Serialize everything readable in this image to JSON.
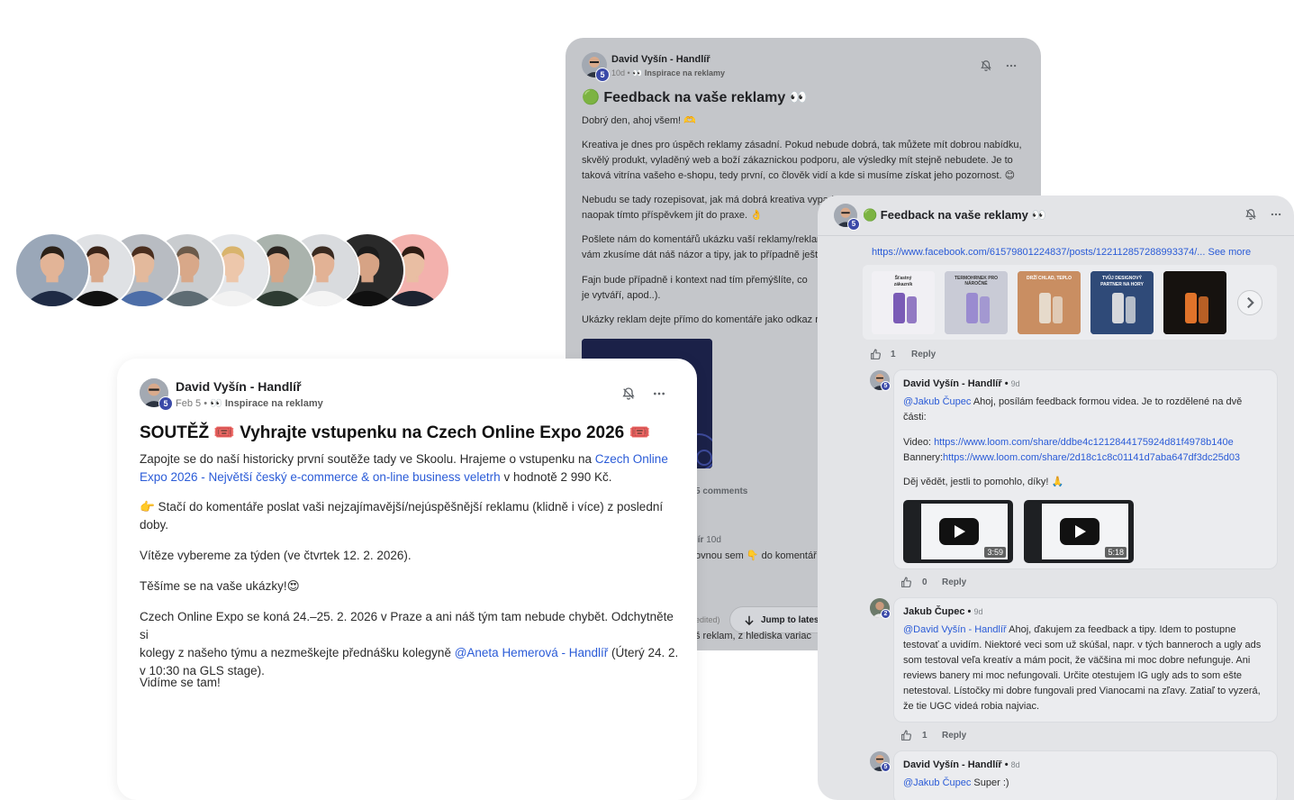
{
  "avatars": [
    {
      "bg": "#9aa7b8",
      "skin": "#e2b497",
      "hair": "#2b2118",
      "shirt": "#1f2b45"
    },
    {
      "bg": "#dfe1e4",
      "skin": "#d9a88a",
      "hair": "#3a2418",
      "shirt": "#111111"
    },
    {
      "bg": "#b8bcc2",
      "skin": "#e3b99c",
      "hair": "#4a2e1e",
      "shirt": "#4d6ea8"
    },
    {
      "bg": "#c9cccf",
      "skin": "#d8a889",
      "hair": "#6b5a4a",
      "shirt": "#5e6c73"
    },
    {
      "bg": "#e4e6e9",
      "skin": "#edc7ab",
      "hair": "#d9b46d",
      "shirt": "#f2f2f2"
    },
    {
      "bg": "#aab3ad",
      "skin": "#d7a686",
      "hair": "#2a241f",
      "shirt": "#2e3b32"
    },
    {
      "bg": "#d9dbde",
      "skin": "#e2b295",
      "hair": "#3a2a20",
      "shirt": "#f4f4f4"
    },
    {
      "bg": "#2a2a2a",
      "skin": "#d6a385",
      "hair": "#1b1b1b",
      "shirt": "#101010"
    },
    {
      "bg": "#f3b1ad",
      "skin": "#e9bea3",
      "hair": "#2f1d14",
      "shirt": "#1d2330"
    }
  ],
  "back_post": {
    "author": "David Vyšín - Handlíř",
    "badge": "5",
    "age": "10d",
    "category_sep": "•",
    "category": "👀 Inspirace na reklamy",
    "title": "🟢 Feedback na vaše reklamy 👀",
    "p1": "Dobrý den, ahoj všem! 🫶",
    "p2a": "Kreativa je dnes pro úspěch reklamy zásadní. Pokud nebude dobrá, tak můžete mít dobrou nabídku,",
    "p2b": "skvělý produkt, vyladěný web a boží zákaznickou podporu, ale výsledky mít stejně nebudete. Je to",
    "p2c": "taková vitrína vašeho e-shopu, tedy první, co člověk vidí a kde si musíme získat jeho pozornost. 😊",
    "p3a": "Nebudu se tady rozepisovat, jak má dobrá kreativa vypadat,",
    "p3b": "naopak tímto příspěvkem jít do praxe. 👌",
    "p4a": "Pošlete nám do komentářů ukázku vaší reklamy/reklam,",
    "p4b": "vám zkusíme dát náš názor a tipy, jak to případně ještě",
    "p5a": "Fajn bude případně i kontext nad tím přemýšlíte, co",
    "p5b": "je vytváří, apod..).",
    "p6": "Ukázky reklam dejte přímo do komentáře jako odkaz na",
    "comments": "5 comments",
    "reply_author": "lír",
    "reply_age": "10d",
    "reply_text": "ovnou sem 👇 do komentář",
    "edited": "edited)",
    "jump_label": "Jump to latest",
    "bottom_text": "š reklam, z hlediska variac"
  },
  "front_post": {
    "author": "David Vyšín - Handlíř",
    "badge": "5",
    "age": "Feb 5",
    "category_sep": "•",
    "category": "👀 Inspirace na reklamy",
    "title": "SOUTĚŽ 🎟️ Vyhrajte vstupenku na Czech Online Expo 2026 🎟️",
    "p1_pre": "Zapojte se do naší historicky první soutěže tady ve Skoolu. Hrajeme o vstupenku na ",
    "p1_link_a": "Czech Online",
    "p1_link_b": "Expo 2026 - Největší český e-commerce & on-line business veletrh",
    "p1_post": " v hodnotě 2 990 Kč.",
    "p2a": "👉 Stačí do komentáře poslat vaši nejzajímavější/nejúspěšnější reklamu (klidně i více) z poslední",
    "p2b": "doby.",
    "p3": "Vítěze vybereme za týden (ve čtvrtek 12. 2. 2026).",
    "p4": "Těšíme se na vaše ukázky!😍",
    "p5a": "Czech Online Expo se koná 24.–25. 2. 2026 v Praze a ani náš tým tam nebude chybět. Odchytněte si",
    "p5b_pre": "kolegy z našeho týmu a nezmeškejte přednášku kolegyně ",
    "p5b_link": "@Aneta Hemerová - Handlíř",
    "p5b_post": " (Úterý 24. 2.",
    "p5c": "v 10:30 na GLS stage).",
    "p6": "Vidíme se tam!"
  },
  "right_panel": {
    "header_badge": "5",
    "header_title": "🟢 Feedback na vaše reklamy 👀",
    "url": "https://www.facebook.com/61579801224837/posts/122112857288993374/...",
    "see_more": " See more",
    "top_likes": "1",
    "reply_label": "Reply",
    "reply1": {
      "author": "David Vyšín - Handlíř",
      "age": "9d",
      "badge": "5",
      "mention": "@Jakub Čupec",
      "line1": " Ahoj, posílám feedback formou videa. Je to rozdělené na dvě",
      "line2": "části:",
      "video_label": "Video: ",
      "video_url": "https://www.loom.com/share/ddbe4c1212844175924d81f4978b140e",
      "banner_label": "Bannery:",
      "banner_url": "https://www.loom.com/share/2d18c1c8c01141d7aba647df3dc25d03",
      "line3": "Děj vědět, jestli to pomohlo, díky! 🙏",
      "dur1": "3:59",
      "dur2": "5:18",
      "likes": "0"
    },
    "reply2": {
      "author": "Jakub Čupec",
      "age": "9d",
      "badge": "2",
      "mention": "@David Vyšín - Handlíř",
      "line1": " Ahoj, ďakujem za feedback a tipy. Idem to postupne",
      "line2": "testovať a uvidím. Niektoré veci som už skúšal, napr. v tých banneroch a ugly ads",
      "line3": "som testoval veľa kreatív a mám pocit, že väčšina mi moc dobre nefunguje. Ani",
      "line4": "reviews banery mi moc nefungovali. Určite otestujem IG ugly ads to som ešte",
      "line5": "netestoval. Lístočky mi dobre fungovali pred Vianocami na zľavy. Zatiaľ to vyzerá,",
      "line6": "že tie UGC videá robia najviac.",
      "likes": "1"
    },
    "reply3": {
      "author": "David Vyšín - Handlíř",
      "age": "8d",
      "badge": "5",
      "mention": "@Jakub Čupec",
      "text": " Super :)"
    },
    "thumbs": [
      {
        "caption_a": "Šťastný",
        "caption_b": "zákazník",
        "bg": "#f1f0f4",
        "accent": "#7a5bb6"
      },
      {
        "caption_a": "TERMOHRNEK PRO NÁROČNÉ",
        "caption_b": "",
        "bg": "#c9cbd6",
        "accent": "#9a8bd0"
      },
      {
        "caption_a": "DRŽÍ CHLAD, TEPLO",
        "caption_b": "",
        "bg": "#c98e62",
        "accent": "#e6dacb"
      },
      {
        "caption_a": "TVŮJ DESIGNOVÝ",
        "caption_b": "PARTNER NA HORY",
        "bg": "#2f4a78",
        "accent": "#d6d8dc"
      },
      {
        "caption_a": "",
        "caption_b": "",
        "bg": "#16120f",
        "accent": "#e0732a"
      }
    ]
  }
}
